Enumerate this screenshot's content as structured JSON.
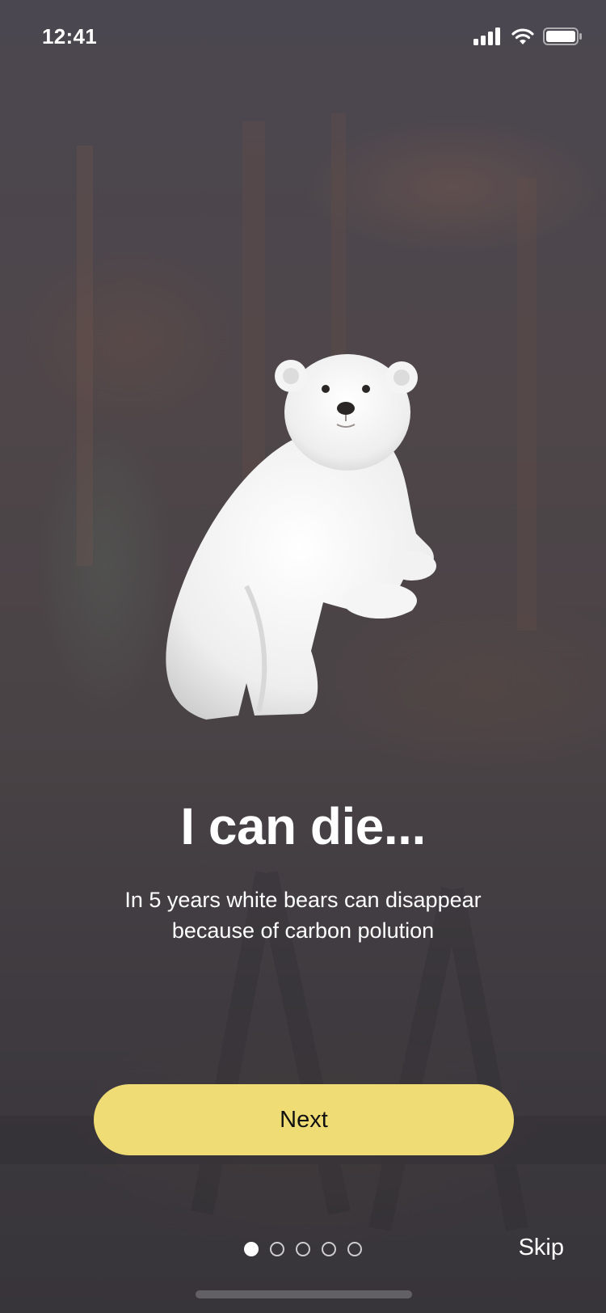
{
  "status_bar": {
    "time": "12:41",
    "icons": [
      "cellular-signal-icon",
      "wifi-icon",
      "battery-icon"
    ]
  },
  "onboarding": {
    "illustration": "polar-bear-cub",
    "headline": "I can die...",
    "subtitle": "In 5 years white bears can  disappear\nbecause of carbon polution",
    "next_label": "Next",
    "skip_label": "Skip",
    "page_count": 5,
    "current_page": 1
  },
  "colors": {
    "button": "#f0dc74",
    "button_text": "#111111",
    "text": "#ffffff",
    "background": "#4a4447"
  }
}
